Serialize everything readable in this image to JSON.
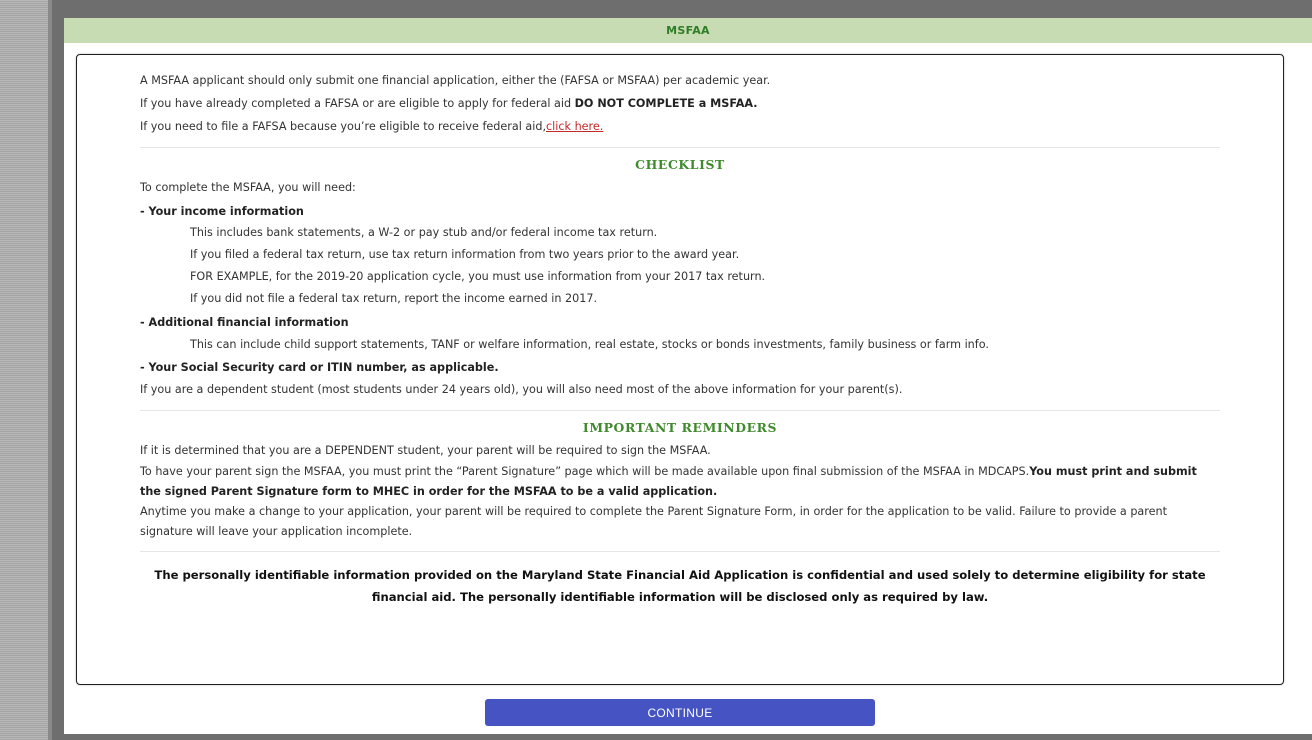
{
  "dialog": {
    "title": "MSFAA"
  },
  "intro": {
    "line1": "A MSFAA applicant should only submit one financial application, either the (FAFSA or MSFAA) per academic year.",
    "line2_prefix": "If you have already completed a FAFSA or are eligible to apply for federal aid ",
    "line2_bold": "DO NOT COMPLETE a MSFAA.",
    "line3_prefix": "If you need to file a FAFSA because you’re eligible to receive federal aid,",
    "line3_link": "click here."
  },
  "checklist": {
    "title": "CHECKLIST",
    "lead": "To complete the MSFAA, you will need:",
    "income": {
      "heading": "- Your income information",
      "lines": [
        "This includes bank statements, a W-2 or pay stub and/or federal income tax return.",
        "If you filed a federal tax return, use tax return information from two years prior to the award year.",
        "FOR EXAMPLE, for the 2019-20 application cycle, you must use information from your 2017 tax return.",
        "If you did not file a federal tax return, report the income earned in 2017."
      ]
    },
    "additional": {
      "heading": "- Additional financial information",
      "text": "This can include child support statements, TANF or welfare information, real estate, stocks or bonds investments, family business or farm info."
    },
    "ssn": {
      "heading": "- Your Social Security card or ITIN number, as applicable."
    },
    "dependent_note": "If you are a dependent student (most students under 24 years old), you will also need most of the above information for your parent(s)."
  },
  "reminders": {
    "title": "IMPORTANT REMINDERS",
    "line1": "If it is determined that you are a DEPENDENT student, your parent will be required to sign the MSFAA.",
    "para2_normal": "To have your parent sign the MSFAA, you must print the “Parent Signature” page which will be made available upon final submission of the MSFAA in MDCAPS.",
    "para2_bold": "You must print and submit the signed Parent Signature form to MHEC in order for the MSFAA to be a valid application.",
    "para3": "Anytime you make a change to your application, your parent will be required to complete the Parent Signature Form, in order for the application to be valid. Failure to provide a parent signature will leave your application incomplete."
  },
  "privacy": {
    "text": "The personally identifiable information provided on the Maryland State Financial Aid Application is confidential and used solely to determine eligibility for state financial aid. The personally identifiable information will be disclosed only as required by law."
  },
  "footer": {
    "continue_label": "CONTINUE"
  },
  "colors": {
    "header_bg": "#c7dcb2",
    "header_text": "#2e7d27",
    "section_title": "#3f8a2c",
    "link": "#c42a2a",
    "button_bg": "#4553c3"
  }
}
